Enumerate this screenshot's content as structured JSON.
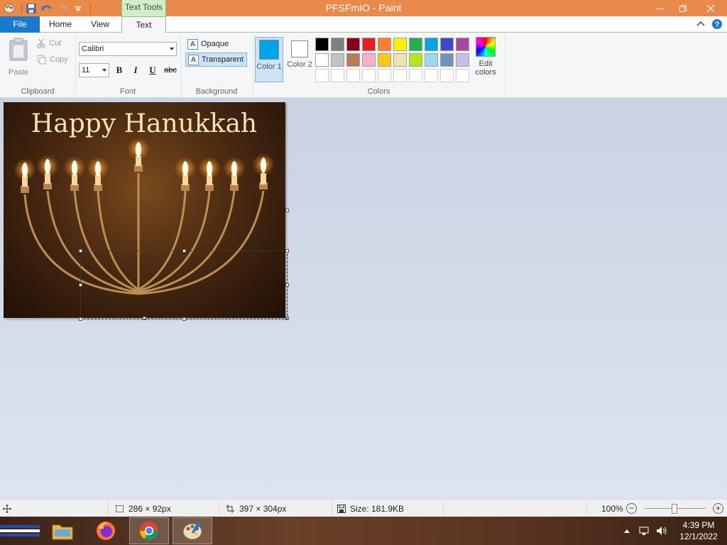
{
  "window": {
    "title": "PFSFmIO - Paint",
    "context_tab_group": "Text Tools"
  },
  "tabs": [
    {
      "label": "File"
    },
    {
      "label": "Home"
    },
    {
      "label": "View"
    },
    {
      "label": "Text"
    }
  ],
  "ribbon": {
    "clipboard": {
      "paste_label": "Paste",
      "cut_label": "Cut",
      "copy_label": "Copy",
      "group_label": "Clipboard"
    },
    "font": {
      "family_value": "Calibri",
      "size_value": "11",
      "bold": "B",
      "italic": "I",
      "underline": "U",
      "strikethrough": "abc",
      "group_label": "Font"
    },
    "background": {
      "opaque_label": "Opaque",
      "transparent_label": "Transparent",
      "selected": "Transparent",
      "group_label": "Background"
    },
    "colors": {
      "color1_label": "Color 1",
      "color1_value": "#00a2e8",
      "color2_label": "Color 2",
      "color2_value": "#ffffff",
      "palette": [
        "#000000",
        "#7f7f7f",
        "#880015",
        "#ed1c24",
        "#ff7f27",
        "#fff200",
        "#22b14c",
        "#00a2e8",
        "#3f48cc",
        "#a349a4",
        "#ffffff",
        "#c3c3c3",
        "#b97a57",
        "#ffaec9",
        "#ffc90e",
        "#efe4b0",
        "#b5e61d",
        "#99d9ea",
        "#7092be",
        "#c8bfe7"
      ],
      "custom_slots": 10,
      "edit_colors_label": "Edit colors",
      "group_label": "Colors"
    }
  },
  "canvas": {
    "greeting_text": "Happy Hanukkah"
  },
  "statusbar": {
    "selection_size": "286 × 92px",
    "image_size": "397 × 304px",
    "file_size": "Size: 181.9KB",
    "zoom": "100%"
  },
  "taskbar": {
    "apps": [
      {
        "name": "file-explorer"
      },
      {
        "name": "firefox"
      },
      {
        "name": "chrome"
      },
      {
        "name": "paint"
      }
    ],
    "clock_time": "4:39 PM",
    "clock_date": "12/1/2022"
  }
}
